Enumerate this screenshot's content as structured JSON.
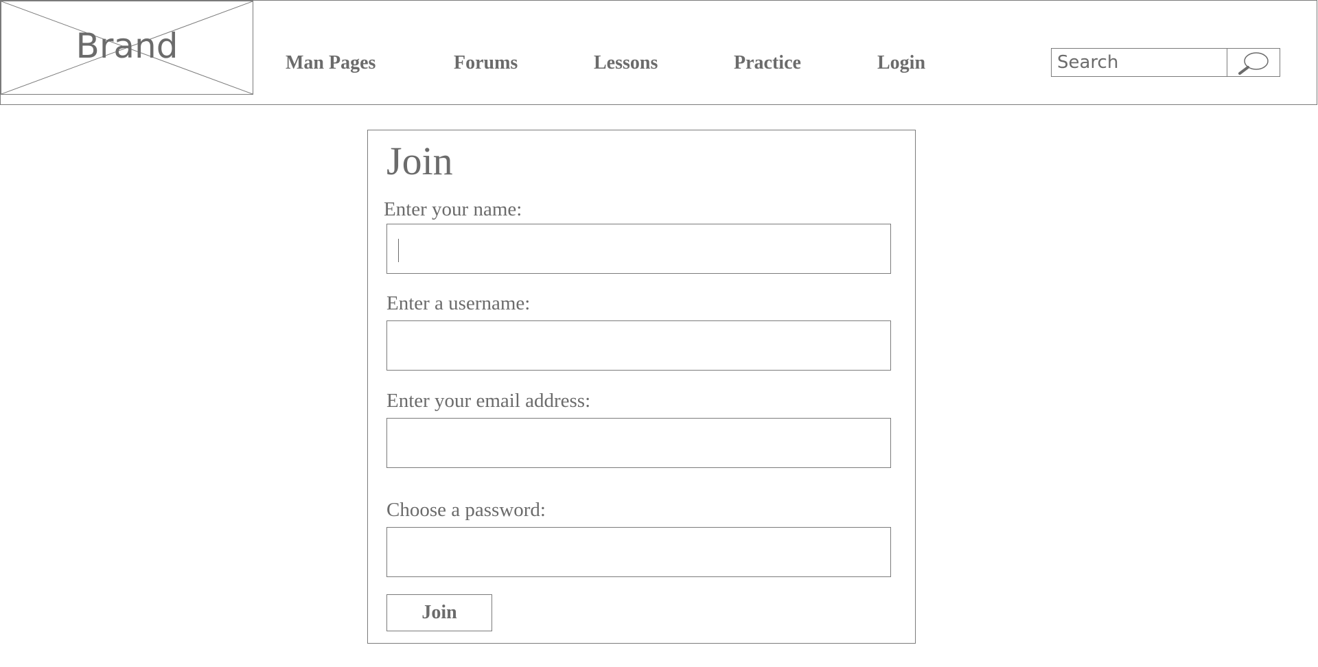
{
  "header": {
    "brand": "Brand",
    "nav": [
      {
        "label": "Man Pages"
      },
      {
        "label": "Forums"
      },
      {
        "label": "Lessons"
      },
      {
        "label": "Practice"
      },
      {
        "label": "Login"
      }
    ],
    "search": {
      "placeholder": "Search",
      "value": ""
    }
  },
  "join_form": {
    "title": "Join",
    "fields": [
      {
        "label": "Enter your name:",
        "value": ""
      },
      {
        "label": "Enter a username:",
        "value": ""
      },
      {
        "label": "Enter your email address:",
        "value": ""
      },
      {
        "label": "Choose a password:",
        "value": ""
      }
    ],
    "submit_label": "Join"
  },
  "icons": {
    "brand_image": "image-placeholder-icon",
    "search": "search-icon"
  },
  "colors": {
    "text": "#6b6b6b",
    "border": "#7a7a7a",
    "background": "#ffffff"
  }
}
